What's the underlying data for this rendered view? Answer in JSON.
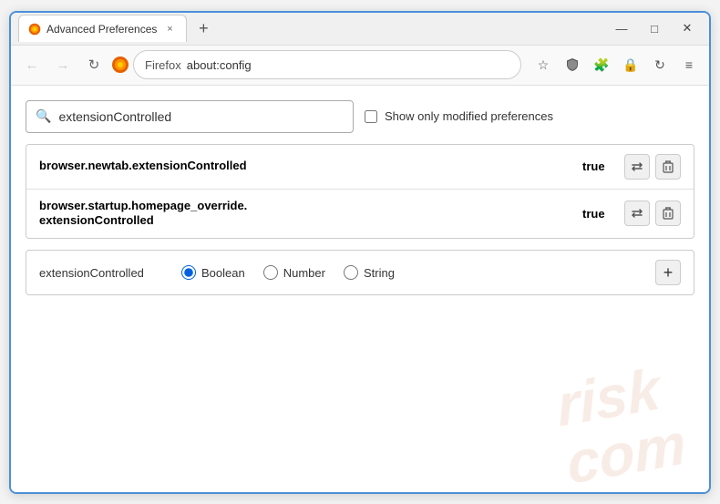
{
  "window": {
    "title": "Advanced Preferences",
    "tab_close": "×",
    "new_tab": "+",
    "minimize": "—",
    "maximize": "□",
    "close": "✕"
  },
  "toolbar": {
    "back_label": "←",
    "forward_label": "→",
    "refresh_label": "↻",
    "site_name": "Firefox",
    "url": "about:config",
    "bookmark_icon": "☆",
    "shield_icon": "🛡",
    "ext_icon": "🧩",
    "lock_icon": "🔒",
    "sync_icon": "↻",
    "menu_icon": "≡"
  },
  "search": {
    "placeholder": "",
    "value": "extensionControlled",
    "checkbox_label": "Show only modified preferences"
  },
  "results": [
    {
      "name": "browser.newtab.extensionControlled",
      "value": "true"
    },
    {
      "name_line1": "browser.startup.homepage_override.",
      "name_line2": "extensionControlled",
      "value": "true"
    }
  ],
  "new_pref": {
    "name": "extensionControlled",
    "type_boolean": "Boolean",
    "type_number": "Number",
    "type_string": "String",
    "add_label": "+"
  },
  "watermark": {
    "line1": "risk",
    "line2": "com"
  }
}
